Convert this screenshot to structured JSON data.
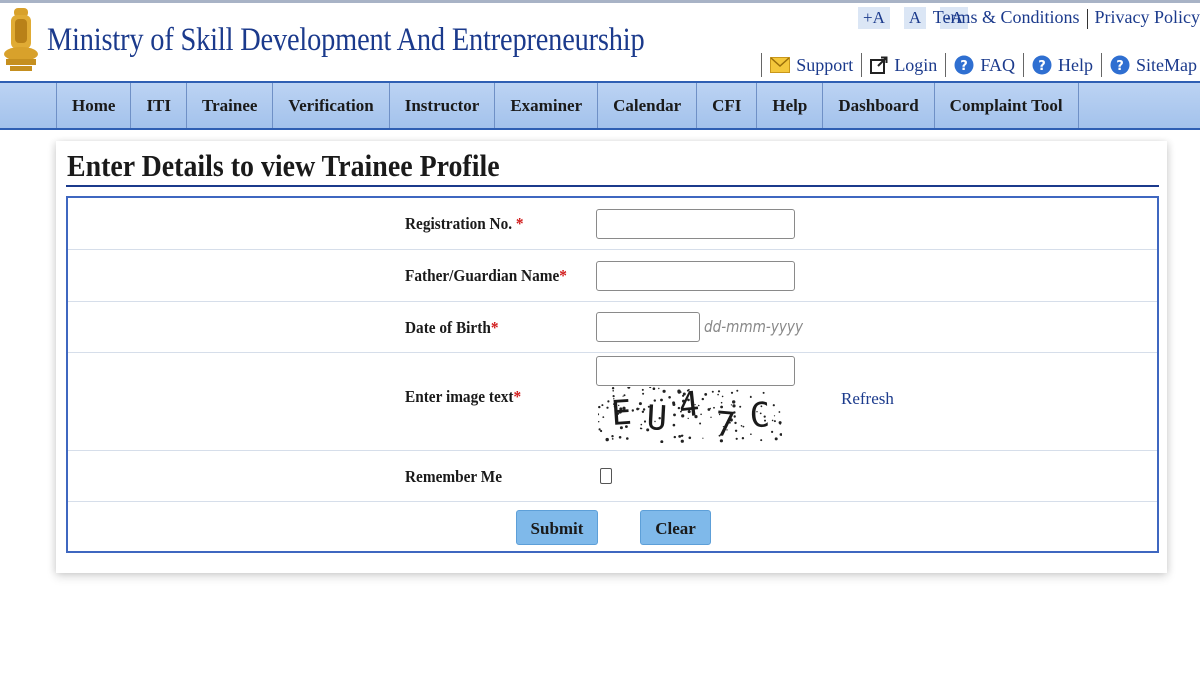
{
  "header": {
    "site_title": "Ministry of Skill Development And Entrepreneurship",
    "font_controls": [
      "+A",
      "A",
      "-A"
    ],
    "top_links": {
      "terms": "Terms & Conditions",
      "privacy": "Privacy Policy"
    },
    "utility": {
      "support": "Support",
      "login": "Login",
      "faq": "FAQ",
      "help": "Help",
      "sitemap": "SiteMap"
    }
  },
  "nav": [
    "Home",
    "ITI",
    "Trainee",
    "Verification",
    "Instructor",
    "Examiner",
    "Calendar",
    "CFI",
    "Help",
    "Dashboard",
    "Complaint Tool"
  ],
  "page": {
    "title": "Enter Details to view Trainee Profile"
  },
  "form": {
    "registration_label": "Registration No.",
    "registration_value": "",
    "father_label": "Father/Guardian Name",
    "father_value": "",
    "dob_label": "Date of Birth",
    "dob_value": "",
    "dob_hint": "dd-mmm-yyyy",
    "captcha_label": "Enter image text",
    "captcha_value": "",
    "captcha_text": "EU47C",
    "refresh_label": "Refresh",
    "remember_label": "Remember Me",
    "required_marker": "*",
    "submit_label": "Submit",
    "clear_label": "Clear"
  },
  "colors": {
    "brand": "#1b3a8c",
    "nav_bg": "#a3c2ec",
    "button_bg": "#7fb9ea",
    "required": "#d11a1a"
  }
}
